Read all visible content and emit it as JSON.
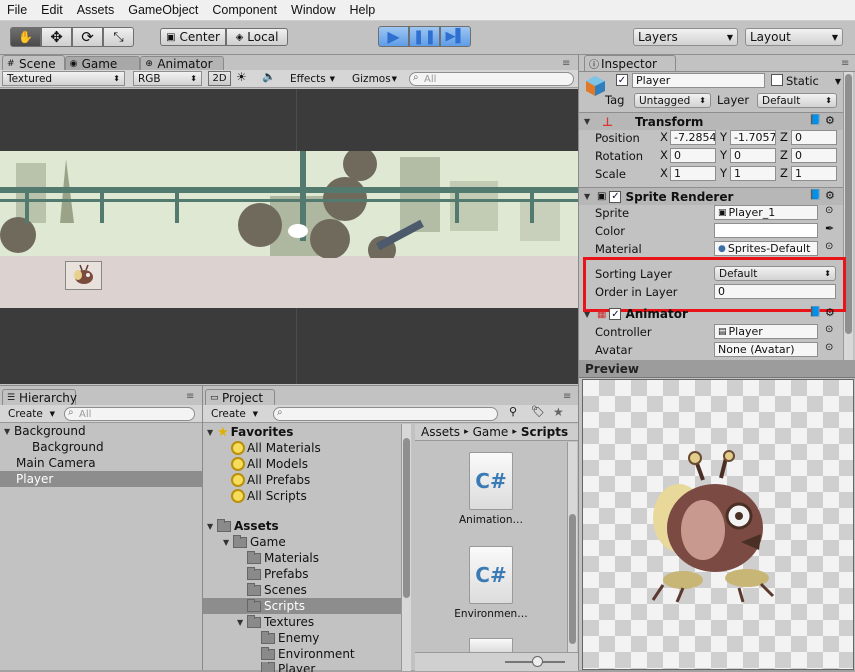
{
  "menu": [
    "File",
    "Edit",
    "Assets",
    "GameObject",
    "Component",
    "Window",
    "Help"
  ],
  "toolbar": {
    "pivot": "Center",
    "space": "Local",
    "layers": "Layers",
    "layout": "Layout"
  },
  "scene": {
    "tabs": {
      "scene": "Scene",
      "game": "Game",
      "animator": "Animator"
    },
    "controls": {
      "render": "Textured",
      "channel": "RGB",
      "mode2d": "2D",
      "effects": "Effects",
      "gizmos": "Gizmos",
      "search": "All"
    }
  },
  "inspector": {
    "tab": "Inspector",
    "name": "Player",
    "static_label": "Static",
    "tag_label": "Tag",
    "tag_value": "Untagged",
    "layer_label": "Layer",
    "layer_value": "Default",
    "transform": {
      "title": "Transform",
      "position": {
        "label": "Position",
        "x": "-7.2854",
        "y": "-1.7057",
        "z": "0"
      },
      "rotation": {
        "label": "Rotation",
        "x": "0",
        "y": "0",
        "z": "0"
      },
      "scale": {
        "label": "Scale",
        "x": "1",
        "y": "1",
        "z": "1"
      }
    },
    "sprite_renderer": {
      "title": "Sprite Renderer",
      "sprite_label": "Sprite",
      "sprite_value": "Player_1",
      "color_label": "Color",
      "material_label": "Material",
      "material_value": "Sprites-Default",
      "sorting_label": "Sorting Layer",
      "sorting_value": "Default",
      "order_label": "Order in Layer",
      "order_value": "0"
    },
    "animator": {
      "title": "Animator",
      "controller_label": "Controller",
      "controller_value": "Player",
      "avatar_label": "Avatar",
      "avatar_value": "None (Avatar)"
    },
    "preview": "Preview"
  },
  "hierarchy": {
    "tab": "Hierarchy",
    "create": "Create",
    "search": "All",
    "items": [
      "Background",
      "Background",
      "Main Camera",
      "Player"
    ]
  },
  "project": {
    "tab": "Project",
    "create": "Create",
    "favorites": "Favorites",
    "fav_items": [
      "All Materials",
      "All Models",
      "All Prefabs",
      "All Scripts"
    ],
    "assets": "Assets",
    "game": "Game",
    "folders": [
      "Materials",
      "Prefabs",
      "Scenes",
      "Scripts",
      "Textures",
      "Enemy",
      "Environment",
      "Player"
    ],
    "breadcrumb": [
      "Assets",
      "Game",
      "Scripts"
    ],
    "files": [
      "Animation…",
      "Environmen…"
    ],
    "cs_glyph": "C#"
  },
  "colors": {
    "highlight": "#e8141a",
    "play_blue": "#2f6fcf",
    "scene_sky": "#dfe8d3"
  }
}
